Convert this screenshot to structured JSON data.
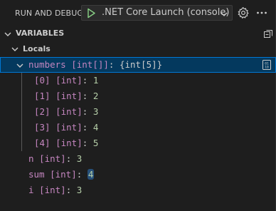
{
  "header": {
    "title": "RUN AND DEBUG",
    "config_name": ".NET Core Launch (console)"
  },
  "section": {
    "title": "VARIABLES"
  },
  "scope": {
    "label": "Locals"
  },
  "variables": [
    {
      "name": "numbers",
      "type": "[int[]]",
      "sep": ":",
      "value": "{int[5]}"
    },
    {
      "name": "[0]",
      "type": "[int]",
      "sep": ":",
      "value": "1"
    },
    {
      "name": "[1]",
      "type": "[int]",
      "sep": ":",
      "value": "2"
    },
    {
      "name": "[2]",
      "type": "[int]",
      "sep": ":",
      "value": "3"
    },
    {
      "name": "[3]",
      "type": "[int]",
      "sep": ":",
      "value": "4"
    },
    {
      "name": "[4]",
      "type": "[int]",
      "sep": ":",
      "value": "5"
    },
    {
      "name": "n",
      "type": "[int]",
      "sep": ":",
      "value": "3"
    },
    {
      "name": "sum",
      "type": "[int]",
      "sep": ":",
      "value": "4"
    },
    {
      "name": "i",
      "type": "[int]",
      "sep": ":",
      "value": "3"
    }
  ],
  "colors": {
    "background": "#1e1e1e",
    "selection": "#04395e",
    "selection_border": "#0078d4",
    "play_green": "#89d185",
    "var_name": "#c586c0",
    "number_value": "#b5cea8"
  },
  "icons": [
    "play-icon",
    "chevron-down-icon",
    "gear-icon",
    "ellipsis-icon",
    "collapse-all-icon",
    "view-binary-icon"
  ]
}
